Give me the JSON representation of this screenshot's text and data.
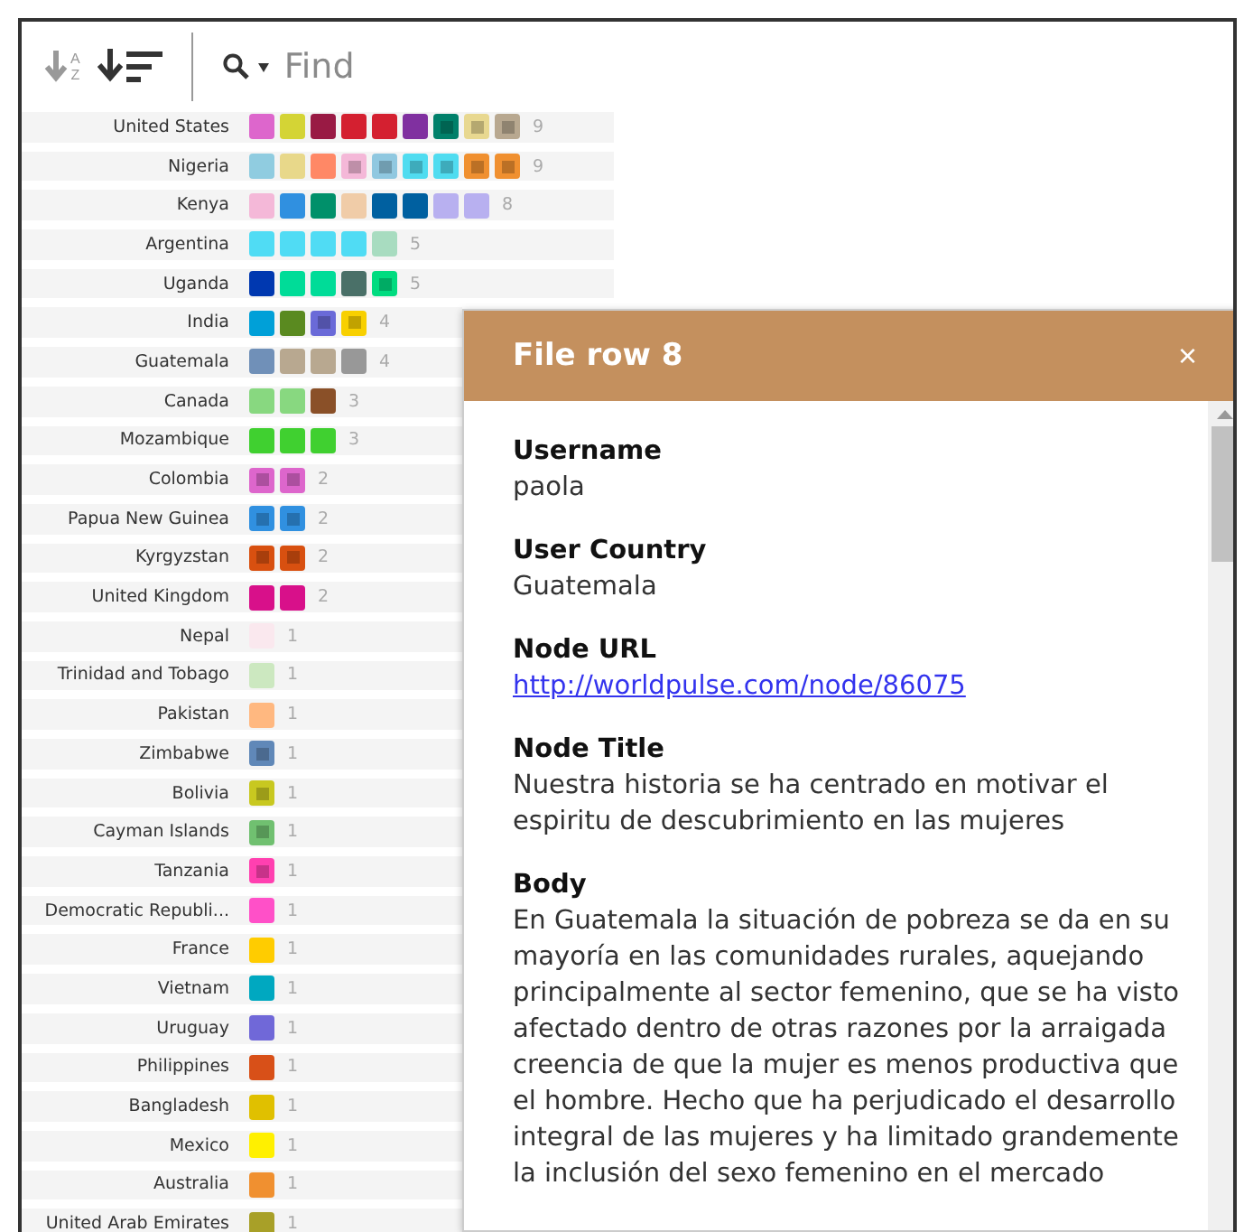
{
  "toolbar": {
    "sort_letters": [
      "A",
      "Z"
    ],
    "search": {
      "placeholder": "Find"
    }
  },
  "rows": [
    {
      "label": "United States",
      "count": "9",
      "squares": [
        {
          "color": "#dd66cc",
          "marked": false
        },
        {
          "color": "#d4d435",
          "marked": false
        },
        {
          "color": "#991a44",
          "marked": false
        },
        {
          "color": "#d42030",
          "marked": false
        },
        {
          "color": "#d42030",
          "marked": false
        },
        {
          "color": "#8030a0",
          "marked": false
        },
        {
          "color": "#00806a",
          "marked": true
        },
        {
          "color": "#e8d890",
          "marked": true
        },
        {
          "color": "#b8a890",
          "marked": true
        }
      ]
    },
    {
      "label": "Nigeria",
      "count": "9",
      "squares": [
        {
          "color": "#90cce0",
          "marked": false
        },
        {
          "color": "#e8d88a",
          "marked": false
        },
        {
          "color": "#ff8866",
          "marked": false
        },
        {
          "color": "#f4b8d8",
          "marked": true
        },
        {
          "color": "#90c8e0",
          "marked": true
        },
        {
          "color": "#50dcf0",
          "marked": true
        },
        {
          "color": "#50dcf0",
          "marked": true
        },
        {
          "color": "#f09030",
          "marked": true
        },
        {
          "color": "#f09030",
          "marked": true
        }
      ]
    },
    {
      "label": "Kenya",
      "count": "8",
      "squares": [
        {
          "color": "#f4b8d8",
          "marked": false
        },
        {
          "color": "#3090e0",
          "marked": false
        },
        {
          "color": "#00906a",
          "marked": false
        },
        {
          "color": "#f0cca8",
          "marked": false
        },
        {
          "color": "#0060a0",
          "marked": false
        },
        {
          "color": "#0060a0",
          "marked": false
        },
        {
          "color": "#b8b0f0",
          "marked": false
        },
        {
          "color": "#b8b0f0",
          "marked": false
        }
      ]
    },
    {
      "label": "Argentina",
      "count": "5",
      "squares": [
        {
          "color": "#50dcf4",
          "marked": false
        },
        {
          "color": "#50dcf4",
          "marked": false
        },
        {
          "color": "#50dcf4",
          "marked": false
        },
        {
          "color": "#50dcf4",
          "marked": false
        },
        {
          "color": "#a8dcc0",
          "marked": false
        }
      ]
    },
    {
      "label": "Uganda",
      "count": "5",
      "squares": [
        {
          "color": "#0038b0",
          "marked": false
        },
        {
          "color": "#00dc98",
          "marked": false
        },
        {
          "color": "#00dc98",
          "marked": false
        },
        {
          "color": "#4a7068",
          "marked": false
        },
        {
          "color": "#00dc80",
          "marked": true
        }
      ]
    },
    {
      "label": "India",
      "count": "4",
      "squares": [
        {
          "color": "#00a0d8",
          "marked": false
        },
        {
          "color": "#5a8a20",
          "marked": false
        },
        {
          "color": "#6a6ad8",
          "marked": true
        },
        {
          "color": "#f8d000",
          "marked": true
        }
      ]
    },
    {
      "label": "Guatemala",
      "count": "4",
      "squares": [
        {
          "color": "#7090b8",
          "marked": false
        },
        {
          "color": "#b8a890",
          "marked": false
        },
        {
          "color": "#b8a890",
          "marked": false
        },
        {
          "color": "#989898",
          "marked": false
        }
      ]
    },
    {
      "label": "Canada",
      "count": "3",
      "squares": [
        {
          "color": "#88d880",
          "marked": false
        },
        {
          "color": "#88d880",
          "marked": false
        },
        {
          "color": "#8a5028",
          "marked": false
        }
      ]
    },
    {
      "label": "Mozambique",
      "count": "3",
      "squares": [
        {
          "color": "#40d030",
          "marked": false
        },
        {
          "color": "#40d030",
          "marked": false
        },
        {
          "color": "#40d030",
          "marked": false
        }
      ]
    },
    {
      "label": "Colombia",
      "count": "2",
      "squares": [
        {
          "color": "#dd66cc",
          "marked": true
        },
        {
          "color": "#dd66cc",
          "marked": true
        }
      ]
    },
    {
      "label": "Papua New Guinea",
      "count": "2",
      "squares": [
        {
          "color": "#3090e0",
          "marked": true
        },
        {
          "color": "#3090e0",
          "marked": true
        }
      ]
    },
    {
      "label": "Kyrgyzstan",
      "count": "2",
      "squares": [
        {
          "color": "#d85010",
          "marked": true
        },
        {
          "color": "#d85010",
          "marked": true
        }
      ]
    },
    {
      "label": "United Kingdom",
      "count": "2",
      "squares": [
        {
          "color": "#d8108a",
          "marked": false
        },
        {
          "color": "#d8108a",
          "marked": false
        }
      ]
    },
    {
      "label": "Nepal",
      "count": "1",
      "squares": [
        {
          "color": "#fae8ee",
          "marked": false
        }
      ]
    },
    {
      "label": "Trinidad and Tobago",
      "count": "1",
      "squares": [
        {
          "color": "#cce8c0",
          "marked": false
        }
      ]
    },
    {
      "label": "Pakistan",
      "count": "1",
      "squares": [
        {
          "color": "#ffb880",
          "marked": false
        }
      ]
    },
    {
      "label": "Zimbabwe",
      "count": "1",
      "squares": [
        {
          "color": "#6088b8",
          "marked": true
        }
      ]
    },
    {
      "label": "Bolivia",
      "count": "1",
      "squares": [
        {
          "color": "#c8c820",
          "marked": true
        }
      ]
    },
    {
      "label": "Cayman Islands",
      "count": "1",
      "squares": [
        {
          "color": "#70c070",
          "marked": true
        }
      ]
    },
    {
      "label": "Tanzania",
      "count": "1",
      "squares": [
        {
          "color": "#ff40b0",
          "marked": true
        }
      ]
    },
    {
      "label": "Democratic Republi...",
      "count": "1",
      "squares": [
        {
          "color": "#ff50c8",
          "marked": false
        }
      ]
    },
    {
      "label": "France",
      "count": "1",
      "squares": [
        {
          "color": "#ffcc00",
          "marked": false
        }
      ]
    },
    {
      "label": "Vietnam",
      "count": "1",
      "squares": [
        {
          "color": "#00a8c0",
          "marked": false
        }
      ]
    },
    {
      "label": "Uruguay",
      "count": "1",
      "squares": [
        {
          "color": "#7068d8",
          "marked": false
        }
      ]
    },
    {
      "label": "Philippines",
      "count": "1",
      "squares": [
        {
          "color": "#d85018",
          "marked": false
        }
      ]
    },
    {
      "label": "Bangladesh",
      "count": "1",
      "squares": [
        {
          "color": "#e0c000",
          "marked": false
        }
      ]
    },
    {
      "label": "Mexico",
      "count": "1",
      "squares": [
        {
          "color": "#fff000",
          "marked": false
        }
      ]
    },
    {
      "label": "Australia",
      "count": "1",
      "squares": [
        {
          "color": "#f09030",
          "marked": false
        }
      ]
    },
    {
      "label": "United Arab Emirates",
      "count": "1",
      "squares": [
        {
          "color": "#a8a028",
          "marked": false
        }
      ]
    }
  ],
  "panel": {
    "title": "File row 8",
    "close": "×",
    "fields": [
      {
        "label": "Username",
        "value": "paola",
        "kind": "text"
      },
      {
        "label": "User Country",
        "value": "Guatemala",
        "kind": "text"
      },
      {
        "label": "Node URL",
        "value": "http://worldpulse.com/node/86075",
        "kind": "link"
      },
      {
        "label": "Node Title",
        "value": "Nuestra historia se ha centrado en motivar el espiritu de descubrimiento en las mujeres",
        "kind": "text"
      },
      {
        "label": "Body",
        "value": "En Guatemala la situación de pobreza se da en su mayoría en las comunidades rurales, aquejando principalmente al sector femenino, que se ha visto afectado dentro de otras razones por la arraigada creencia de que la mujer es menos productiva que el hombre. Hecho que ha perjudicado el desarrollo integral de las mujeres y ha limitado grandemente la inclusión del sexo femenino en el mercado",
        "kind": "text"
      }
    ]
  }
}
